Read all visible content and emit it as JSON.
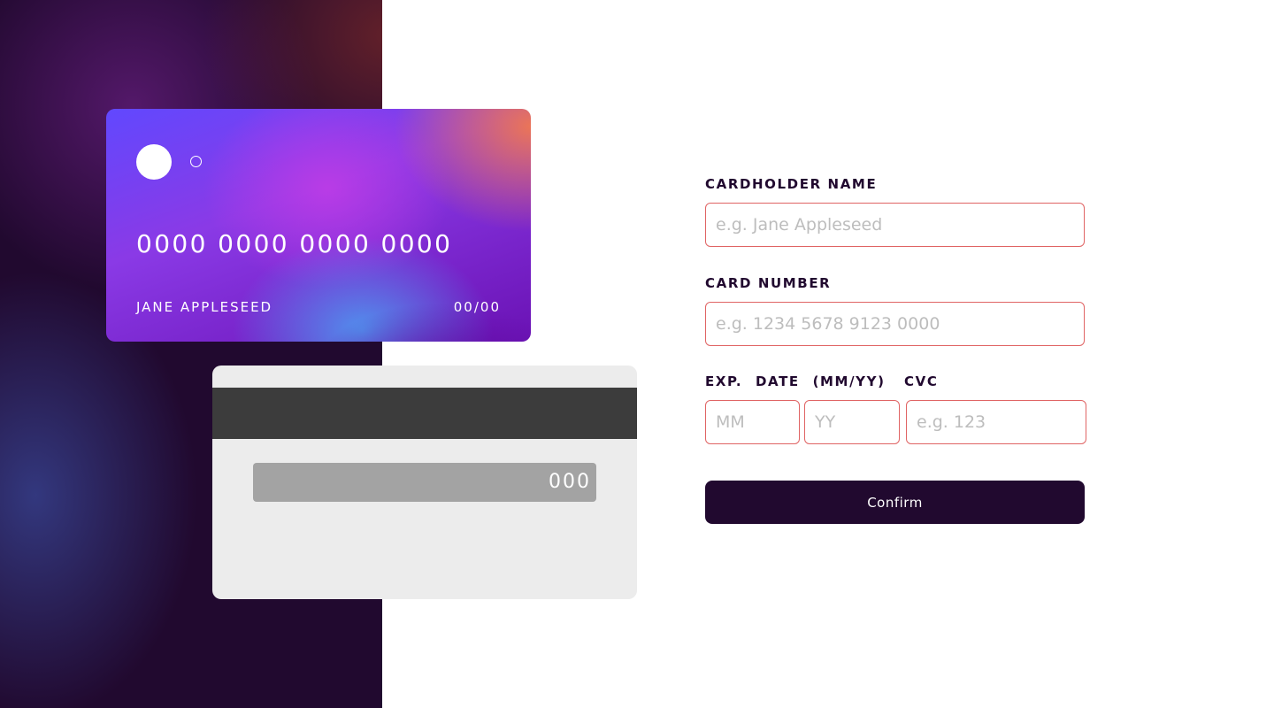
{
  "card_front": {
    "number": "0000 0000 0000 0000",
    "holder": "JANE APPLESEED",
    "expiry": "00/00"
  },
  "card_back": {
    "cvc": "000"
  },
  "form": {
    "cardholder": {
      "label": "CARDHOLDER NAME",
      "placeholder": "e.g. Jane Appleseed",
      "value": ""
    },
    "card_number": {
      "label": "CARD NUMBER",
      "placeholder": "e.g. 1234 5678 9123 0000",
      "value": ""
    },
    "exp_date": {
      "label": "EXP. DATE (MM/YY)",
      "month_placeholder": "MM",
      "year_placeholder": "YY"
    },
    "cvc": {
      "label": "CVC",
      "placeholder": "e.g. 123",
      "value": ""
    },
    "confirm_label": "Confirm"
  },
  "colors": {
    "side_panel": "#21092f",
    "button": "#21092f",
    "input_border": "#e06464",
    "placeholder": "#bdbdbd",
    "card_back": "#ececec",
    "magnetic_strip": "#3c3c3c",
    "cvc_strip": "#a3a3a3"
  }
}
